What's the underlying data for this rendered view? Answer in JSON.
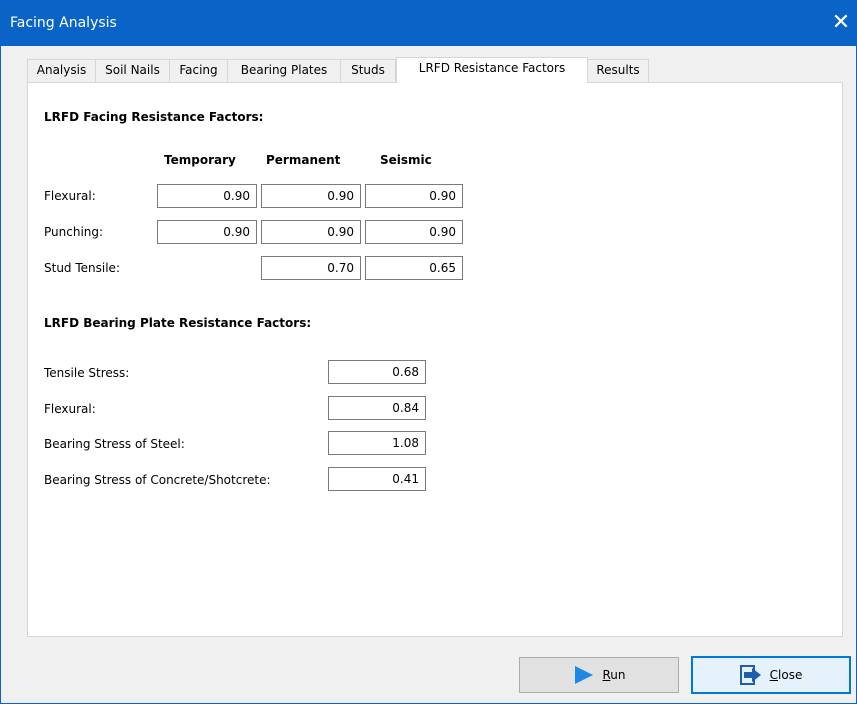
{
  "window": {
    "title": "Facing Analysis",
    "close_glyph": "✕"
  },
  "tabs": [
    {
      "label": "Analysis",
      "active": false
    },
    {
      "label": "Soil Nails",
      "active": false
    },
    {
      "label": "Facing",
      "active": false
    },
    {
      "label": "Bearing Plates",
      "active": false
    },
    {
      "label": "Studs",
      "active": false
    },
    {
      "label": "LRFD Resistance Factors",
      "active": true
    },
    {
      "label": "Results",
      "active": false
    }
  ],
  "facing_section": {
    "heading": "LRFD Facing Resistance Factors:",
    "columns": [
      "Temporary",
      "Permanent",
      "Seismic"
    ],
    "rows": [
      {
        "label": "Flexural:",
        "temporary": "0.90",
        "permanent": "0.90",
        "seismic": "0.90"
      },
      {
        "label": "Punching:",
        "temporary": "0.90",
        "permanent": "0.90",
        "seismic": "0.90"
      },
      {
        "label": "Stud Tensile:",
        "permanent": "0.70",
        "seismic": "0.65"
      }
    ]
  },
  "bearing_section": {
    "heading": "LRFD Bearing Plate Resistance Factors:",
    "rows": [
      {
        "label": "Tensile Stress:",
        "value": "0.68"
      },
      {
        "label": "Flexural:",
        "value": "0.84"
      },
      {
        "label": "Bearing Stress of Steel:",
        "value": "1.08"
      },
      {
        "label": "Bearing Stress of Concrete/Shotcrete:",
        "value": "0.41"
      }
    ]
  },
  "buttons": {
    "run": {
      "label_mnemonic": "R",
      "label_rest": "un",
      "icon": "play-arrow-icon"
    },
    "close": {
      "label_mnemonic": "C",
      "label_rest": "lose",
      "icon": "exit-door-icon"
    }
  },
  "colors": {
    "titlebar": "#0a64c8",
    "run_icon": "#1e88e5",
    "close_icon": "#1f5fa8"
  }
}
